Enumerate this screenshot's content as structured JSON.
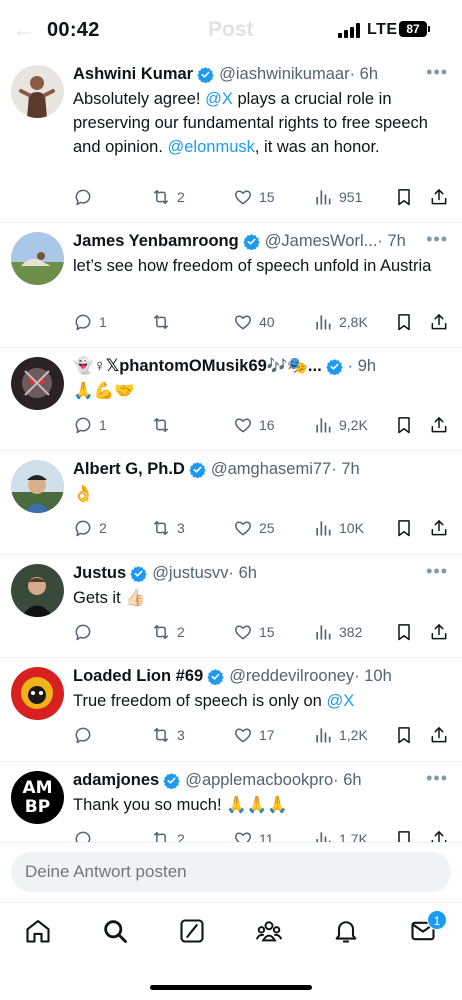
{
  "status_bar": {
    "time": "00:42",
    "network": "LTE",
    "battery": "87"
  },
  "header": {
    "title": "Post"
  },
  "colors": {
    "accent": "#1d9bf0",
    "text": "#0f1419",
    "secondary": "#536471"
  },
  "replies": [
    {
      "name": "Ashwini Kumar",
      "handle": "@iashwinikumaar",
      "time": "· 6h",
      "text_parts": [
        "Absolutely agree! ",
        "@X",
        " plays a crucial role in preserving our fundamental rights to free speech and opinion. ",
        "@elonmusk",
        ", it was an honor."
      ],
      "reply_count": "",
      "retweets": "2",
      "likes": "15",
      "views": "951"
    },
    {
      "name": "James Yenbamroong",
      "handle": "@JamesWorl...",
      "time": "· 7h",
      "text": "let’s see how freedom of speech unfold in Austria",
      "reply_count": "1",
      "retweets": "",
      "likes": "40",
      "views": "2,8K"
    },
    {
      "name": "👻♀𝕏phantomOMusik69🎶🎭...",
      "handle": "",
      "time": "· 9h",
      "text": "🙏💪🤝",
      "reply_count": "1",
      "retweets": "",
      "likes": "16",
      "views": "9,2K"
    },
    {
      "name": "Albert G, Ph.D",
      "handle": "@amghasemi77",
      "time": "· 7h",
      "text": "👌",
      "reply_count": "2",
      "retweets": "3",
      "likes": "25",
      "views": "10K"
    },
    {
      "name": "Justus",
      "handle": "@justusvv",
      "time": "· 6h",
      "text": "Gets it 👍🏻",
      "reply_count": "",
      "retweets": "2",
      "likes": "15",
      "views": "382"
    },
    {
      "name": "Loaded Lion #69",
      "handle": "@reddevilrooney",
      "time": "· 10h",
      "text_parts": [
        "True freedom of speech is only on ",
        "@X"
      ],
      "reply_count": "",
      "retweets": "3",
      "likes": "17",
      "views": "1,2K"
    },
    {
      "name": "adamjones",
      "handle": "@applemacbookpro",
      "time": "· 6h",
      "text": "Thank you so much! 🙏🙏🙏",
      "reply_count": "",
      "retweets": "2",
      "likes": "11",
      "views": "1,7K",
      "avatar_text": [
        "AM",
        "BP"
      ]
    }
  ],
  "reply_bar": {
    "placeholder": "Deine Antwort posten"
  },
  "nav": {
    "items": [
      "home-icon",
      "search-icon",
      "grok-icon",
      "communities-icon",
      "notifications-icon",
      "messages-icon"
    ],
    "messages_badge": "1"
  }
}
